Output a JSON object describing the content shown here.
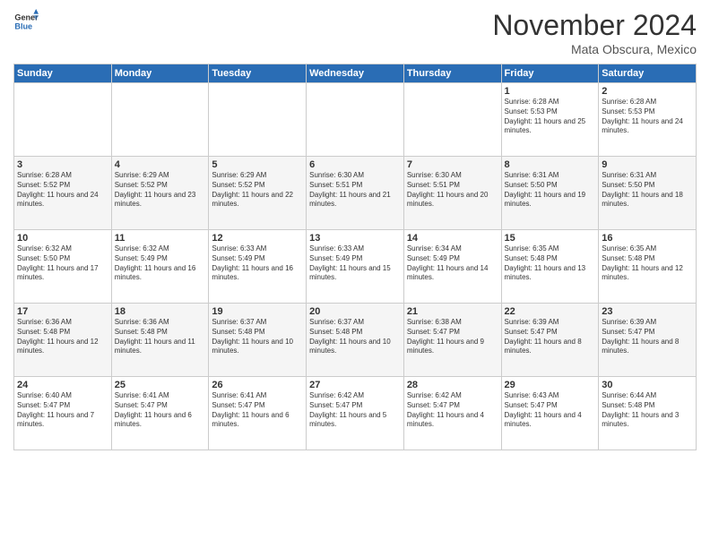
{
  "header": {
    "logo_general": "General",
    "logo_blue": "Blue",
    "title": "November 2024",
    "location": "Mata Obscura, Mexico"
  },
  "days_of_week": [
    "Sunday",
    "Monday",
    "Tuesday",
    "Wednesday",
    "Thursday",
    "Friday",
    "Saturday"
  ],
  "weeks": [
    [
      {
        "day": "",
        "info": ""
      },
      {
        "day": "",
        "info": ""
      },
      {
        "day": "",
        "info": ""
      },
      {
        "day": "",
        "info": ""
      },
      {
        "day": "",
        "info": ""
      },
      {
        "day": "1",
        "info": "Sunrise: 6:28 AM\nSunset: 5:53 PM\nDaylight: 11 hours and 25 minutes."
      },
      {
        "day": "2",
        "info": "Sunrise: 6:28 AM\nSunset: 5:53 PM\nDaylight: 11 hours and 24 minutes."
      }
    ],
    [
      {
        "day": "3",
        "info": "Sunrise: 6:28 AM\nSunset: 5:52 PM\nDaylight: 11 hours and 24 minutes."
      },
      {
        "day": "4",
        "info": "Sunrise: 6:29 AM\nSunset: 5:52 PM\nDaylight: 11 hours and 23 minutes."
      },
      {
        "day": "5",
        "info": "Sunrise: 6:29 AM\nSunset: 5:52 PM\nDaylight: 11 hours and 22 minutes."
      },
      {
        "day": "6",
        "info": "Sunrise: 6:30 AM\nSunset: 5:51 PM\nDaylight: 11 hours and 21 minutes."
      },
      {
        "day": "7",
        "info": "Sunrise: 6:30 AM\nSunset: 5:51 PM\nDaylight: 11 hours and 20 minutes."
      },
      {
        "day": "8",
        "info": "Sunrise: 6:31 AM\nSunset: 5:50 PM\nDaylight: 11 hours and 19 minutes."
      },
      {
        "day": "9",
        "info": "Sunrise: 6:31 AM\nSunset: 5:50 PM\nDaylight: 11 hours and 18 minutes."
      }
    ],
    [
      {
        "day": "10",
        "info": "Sunrise: 6:32 AM\nSunset: 5:50 PM\nDaylight: 11 hours and 17 minutes."
      },
      {
        "day": "11",
        "info": "Sunrise: 6:32 AM\nSunset: 5:49 PM\nDaylight: 11 hours and 16 minutes."
      },
      {
        "day": "12",
        "info": "Sunrise: 6:33 AM\nSunset: 5:49 PM\nDaylight: 11 hours and 16 minutes."
      },
      {
        "day": "13",
        "info": "Sunrise: 6:33 AM\nSunset: 5:49 PM\nDaylight: 11 hours and 15 minutes."
      },
      {
        "day": "14",
        "info": "Sunrise: 6:34 AM\nSunset: 5:49 PM\nDaylight: 11 hours and 14 minutes."
      },
      {
        "day": "15",
        "info": "Sunrise: 6:35 AM\nSunset: 5:48 PM\nDaylight: 11 hours and 13 minutes."
      },
      {
        "day": "16",
        "info": "Sunrise: 6:35 AM\nSunset: 5:48 PM\nDaylight: 11 hours and 12 minutes."
      }
    ],
    [
      {
        "day": "17",
        "info": "Sunrise: 6:36 AM\nSunset: 5:48 PM\nDaylight: 11 hours and 12 minutes."
      },
      {
        "day": "18",
        "info": "Sunrise: 6:36 AM\nSunset: 5:48 PM\nDaylight: 11 hours and 11 minutes."
      },
      {
        "day": "19",
        "info": "Sunrise: 6:37 AM\nSunset: 5:48 PM\nDaylight: 11 hours and 10 minutes."
      },
      {
        "day": "20",
        "info": "Sunrise: 6:37 AM\nSunset: 5:48 PM\nDaylight: 11 hours and 10 minutes."
      },
      {
        "day": "21",
        "info": "Sunrise: 6:38 AM\nSunset: 5:47 PM\nDaylight: 11 hours and 9 minutes."
      },
      {
        "day": "22",
        "info": "Sunrise: 6:39 AM\nSunset: 5:47 PM\nDaylight: 11 hours and 8 minutes."
      },
      {
        "day": "23",
        "info": "Sunrise: 6:39 AM\nSunset: 5:47 PM\nDaylight: 11 hours and 8 minutes."
      }
    ],
    [
      {
        "day": "24",
        "info": "Sunrise: 6:40 AM\nSunset: 5:47 PM\nDaylight: 11 hours and 7 minutes."
      },
      {
        "day": "25",
        "info": "Sunrise: 6:41 AM\nSunset: 5:47 PM\nDaylight: 11 hours and 6 minutes."
      },
      {
        "day": "26",
        "info": "Sunrise: 6:41 AM\nSunset: 5:47 PM\nDaylight: 11 hours and 6 minutes."
      },
      {
        "day": "27",
        "info": "Sunrise: 6:42 AM\nSunset: 5:47 PM\nDaylight: 11 hours and 5 minutes."
      },
      {
        "day": "28",
        "info": "Sunrise: 6:42 AM\nSunset: 5:47 PM\nDaylight: 11 hours and 4 minutes."
      },
      {
        "day": "29",
        "info": "Sunrise: 6:43 AM\nSunset: 5:47 PM\nDaylight: 11 hours and 4 minutes."
      },
      {
        "day": "30",
        "info": "Sunrise: 6:44 AM\nSunset: 5:48 PM\nDaylight: 11 hours and 3 minutes."
      }
    ]
  ]
}
